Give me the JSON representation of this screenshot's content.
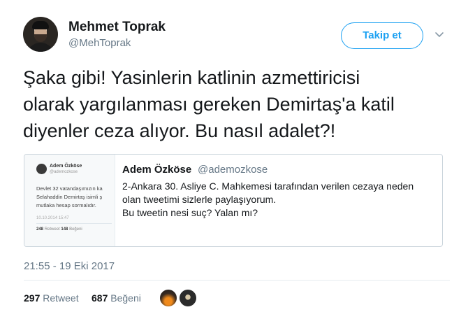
{
  "author": {
    "display_name": "Mehmet Toprak",
    "handle": "@MehToprak"
  },
  "follow_button": {
    "label": "Takip et",
    "color": "#1da1f2"
  },
  "tweet": {
    "text": "Şaka gibi! Yasinlerin katlinin azmettiricisi\nolarak yargılanması gereken Demirtaş'a katil\ndiyenler ceza alıyor. Bu nasıl adalet?!",
    "timestamp": "21:55 - 19 Eki 2017"
  },
  "quoted_tweet": {
    "display_name": "Adem Özköse",
    "handle": "@ademozkose",
    "text": "2-Ankara 30. Asliye C. Mahkemesi tarafından verilen cezaya neden\nolan tweetimi sizlerle paylaşıyorum.\nBu tweetin nesi suç? Yalan mı?",
    "thumbnail": {
      "name": "Adem Özköse",
      "handle": "@ademozkose",
      "lines": [
        "Devlet 32 vatandaşımızın ka",
        "Selahaddin Demirtaş isimli ş",
        "mutlaka hesap sormalıdır."
      ],
      "date": "10.10.2014 15:47",
      "retweet_count": "248",
      "retweet_label": "Retweet",
      "like_count": "148",
      "like_label": "Beğeni"
    }
  },
  "stats": {
    "retweet_count": "297",
    "retweet_label": "Retweet",
    "like_count": "687",
    "like_label": "Beğeni"
  },
  "colors": {
    "text": "#14171a",
    "secondary": "#657786",
    "accent": "#1da1f2",
    "border": "#ccd6dd"
  }
}
